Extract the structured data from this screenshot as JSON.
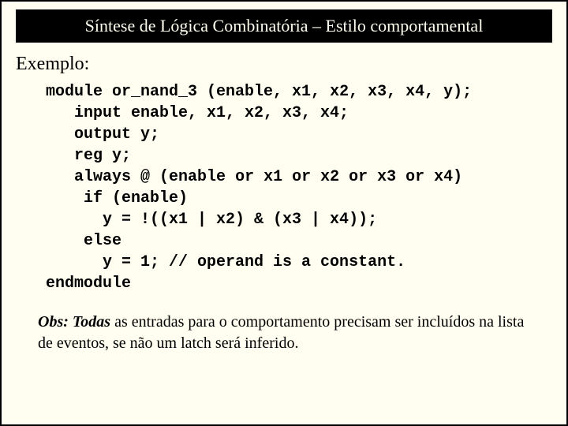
{
  "title": "Síntese de Lógica Combinatória – Estilo comportamental",
  "example_label": "Exemplo:",
  "code": {
    "l1a": "module",
    "l1b": " or_nand_3 (enable, x1, x2, x3, x4, y);",
    "l2a": "   input",
    "l2b": " enable, x1, x2, x3, x4;",
    "l3a": "   output",
    "l3b": " y;",
    "l4a": "   reg",
    "l4b": " y;",
    "l5a": "   always",
    "l5b": " @ (enable ",
    "l5c": "or",
    "l5d": " x1 ",
    "l5e": "or",
    "l5f": " x2 ",
    "l5g": "or",
    "l5h": " x3 ",
    "l5i": "or",
    "l5j": " x4)",
    "l6a": "    if",
    "l6b": " (enable)",
    "l7": "      y = !((x1 | x2) & (x3 | x4));",
    "l8a": "    else",
    "l9": "      y = 1; // operand is a constant.",
    "l10": "endmodule"
  },
  "note": {
    "prefix": "Obs: Todas",
    "rest": " as entradas para o comportamento precisam ser incluídos na lista de eventos, se não um latch será inferido."
  }
}
